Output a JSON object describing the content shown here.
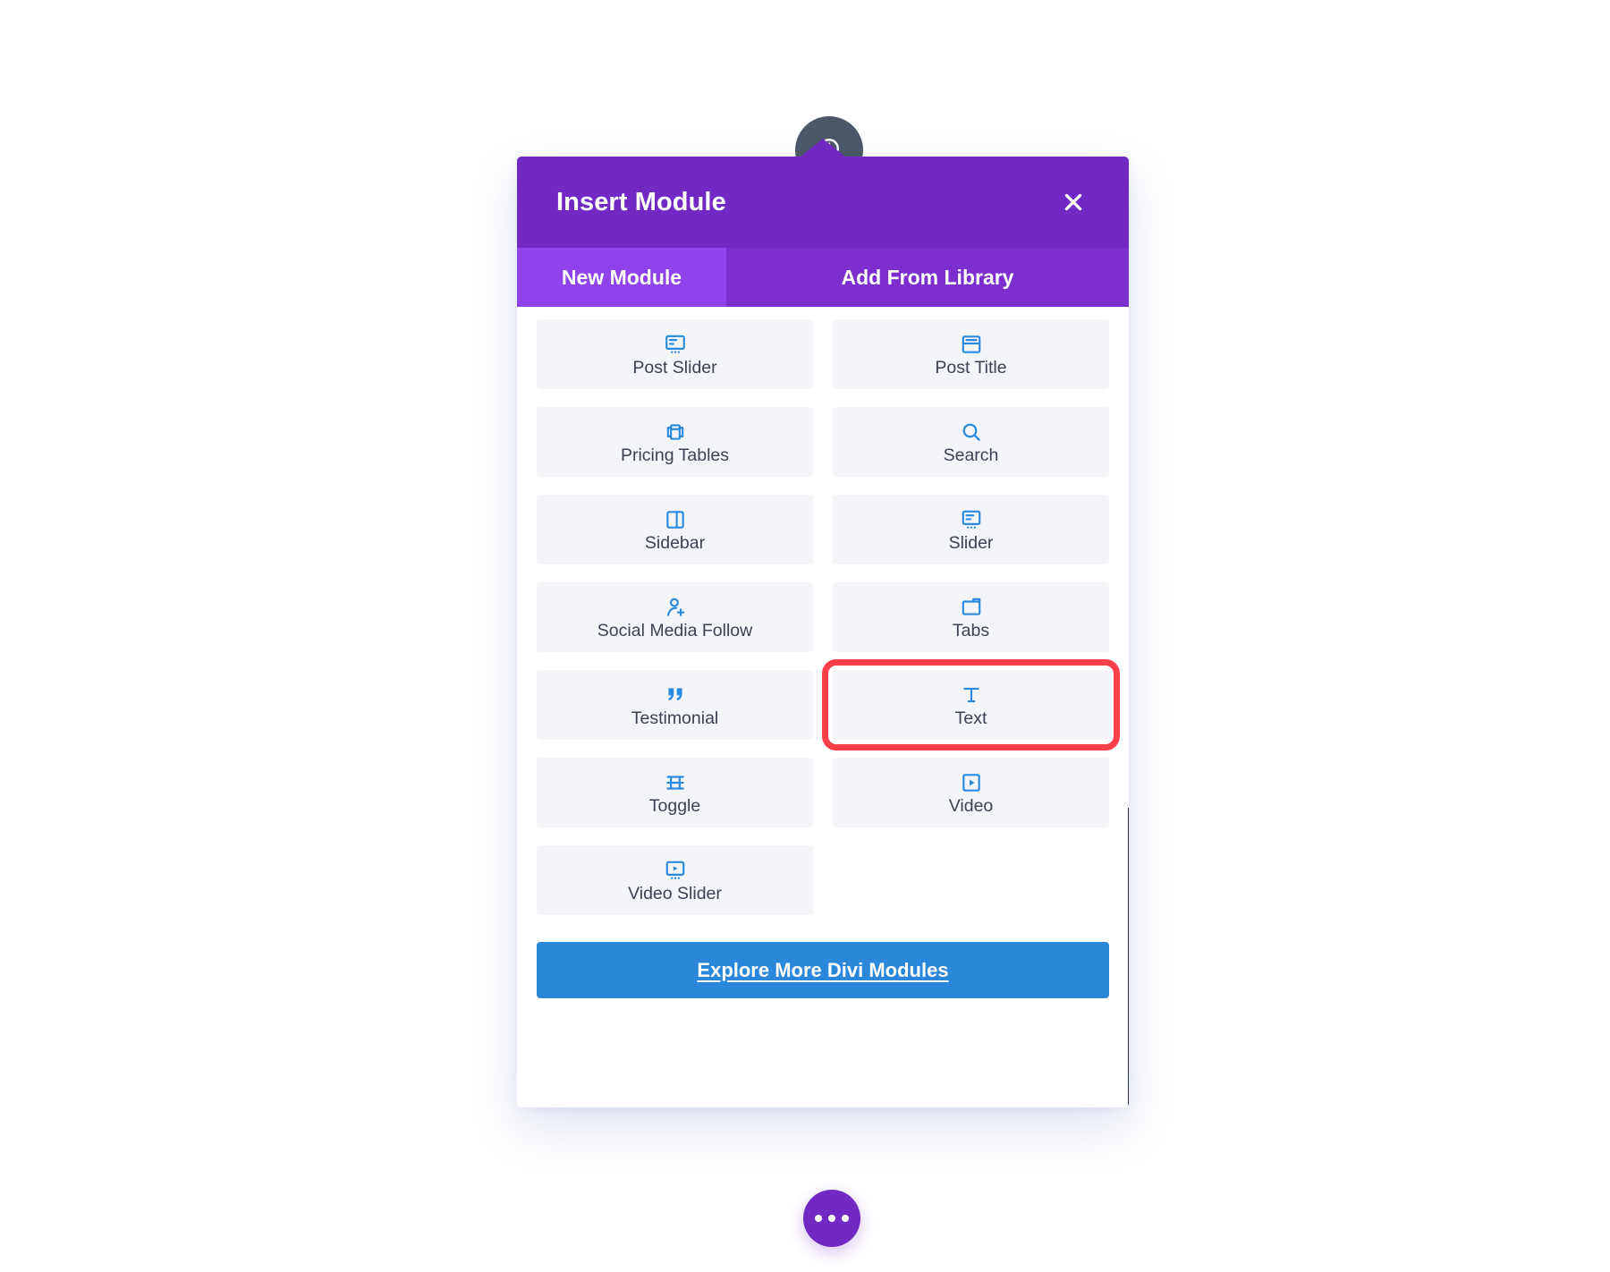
{
  "modal": {
    "title": "Insert Module",
    "close_label": "close-icon",
    "tabs": [
      {
        "label": "New Module",
        "active": true
      },
      {
        "label": "Add From Library",
        "active": false
      }
    ],
    "explore_button": "Explore More Divi Modules"
  },
  "colors": {
    "header_purple": "#7229c4",
    "tab_active_purple": "#9043ea",
    "tab_bar_purple": "#7c2fce",
    "card_bg": "#f3f5f8",
    "icon_blue": "#2a8ae0",
    "explore_blue": "#2b87da",
    "highlight_red": "#f9404a",
    "scrollbar_dark": "#272e38",
    "clock_bubble": "#4c5866"
  },
  "modules": [
    {
      "label": "Post Slider",
      "icon": "post-slider-icon",
      "highlighted": false
    },
    {
      "label": "Post Title",
      "icon": "post-title-icon",
      "highlighted": false
    },
    {
      "label": "Pricing Tables",
      "icon": "pricing-tables-icon",
      "highlighted": false
    },
    {
      "label": "Search",
      "icon": "search-icon",
      "highlighted": false
    },
    {
      "label": "Sidebar",
      "icon": "sidebar-icon",
      "highlighted": false
    },
    {
      "label": "Slider",
      "icon": "slider-icon",
      "highlighted": false
    },
    {
      "label": "Social Media Follow",
      "icon": "social-media-follow-icon",
      "highlighted": false
    },
    {
      "label": "Tabs",
      "icon": "tabs-icon",
      "highlighted": false
    },
    {
      "label": "Testimonial",
      "icon": "quote-icon",
      "highlighted": false
    },
    {
      "label": "Text",
      "icon": "text-t-icon",
      "highlighted": true
    },
    {
      "label": "Toggle",
      "icon": "toggle-icon",
      "highlighted": false
    },
    {
      "label": "Video",
      "icon": "video-icon",
      "highlighted": false
    },
    {
      "label": "Video Slider",
      "icon": "video-slider-icon",
      "highlighted": false
    }
  ],
  "floating_button": {
    "icon": "ellipsis-icon"
  },
  "clock_badge": {
    "icon": "clock-icon"
  }
}
